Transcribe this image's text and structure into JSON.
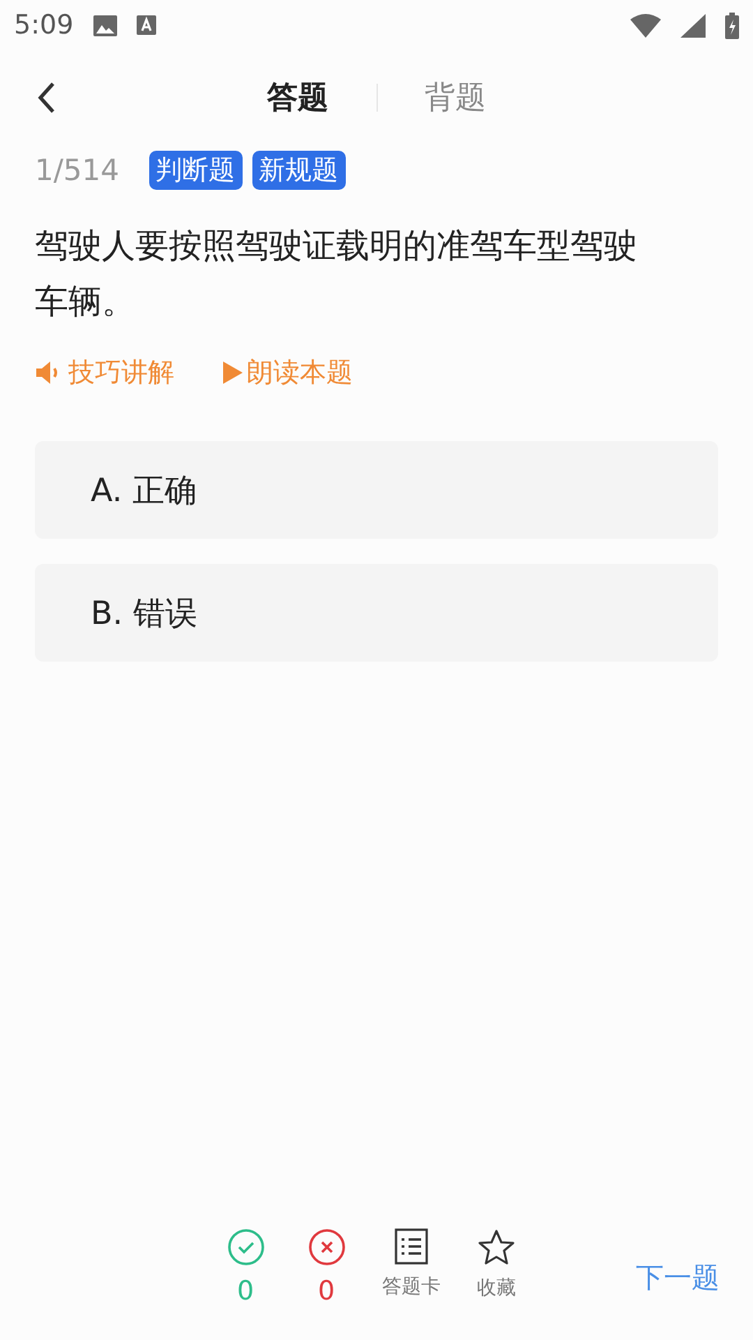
{
  "status_bar": {
    "time": "5:09"
  },
  "tabs": [
    {
      "label": "答题",
      "selected": true
    },
    {
      "label": "背题",
      "selected": false
    }
  ],
  "progress": "1/514",
  "tags": [
    "判断题",
    "新规题"
  ],
  "question": "驾驶人要按照驾驶证载明的准驾车型驾驶车辆。",
  "actions": [
    {
      "kind": "speaker",
      "label": "技巧讲解"
    },
    {
      "kind": "play",
      "label": "朗读本题"
    }
  ],
  "options": [
    "A. 正确",
    "B. 错误"
  ],
  "bottom_bar": {
    "items": [
      {
        "kind": "correct",
        "label": "0"
      },
      {
        "kind": "wrong",
        "label": "0"
      },
      {
        "kind": "card",
        "label": "答题卡"
      },
      {
        "kind": "favorite",
        "label": "收藏"
      }
    ],
    "next": "下一题"
  }
}
